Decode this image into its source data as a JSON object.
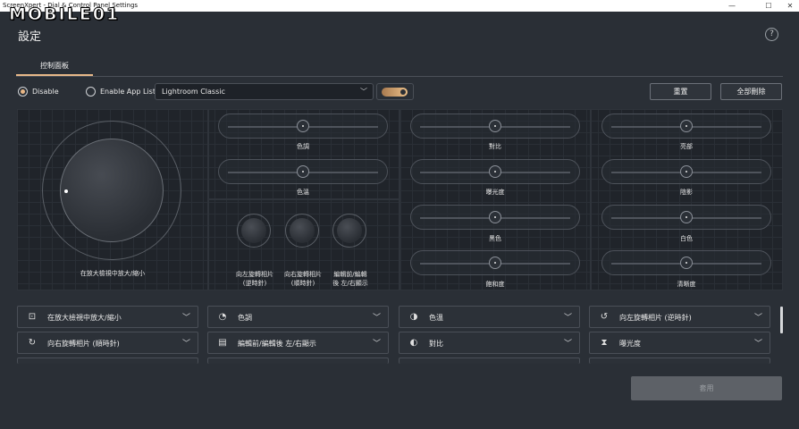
{
  "window": {
    "title": "ScreenXpert - Dial & Control Panel Settings",
    "controls": [
      "—",
      "☐",
      "✕"
    ],
    "watermark": "MOBILE01"
  },
  "header": {
    "title": "設定",
    "help": "?"
  },
  "tabs": [
    {
      "label": "控制面板",
      "active": true
    }
  ],
  "toolbar": {
    "disable_label": "Disable",
    "disable_selected": true,
    "enable_app_list_label": "Enable App List",
    "app_select_value": "Lightroom Classic",
    "toggle_on": true,
    "reset_label": "重置",
    "delete_all_label": "全部刪除"
  },
  "colors": {
    "accent": "#e9b786",
    "background": "#2a2f36",
    "panel": "#20242a"
  },
  "dial": {
    "label": "在放大檢視中放大/縮小"
  },
  "mini_dials": [
    {
      "label_line1": "向左旋轉相片",
      "label_line2": "(逆時針)"
    },
    {
      "label_line1": "向右旋轉相片",
      "label_line2": "(順時針)"
    },
    {
      "label_line1": "編輯前/編輯",
      "label_line2": "後 左/右顯示"
    }
  ],
  "sliders": [
    {
      "label": "色調",
      "value": 0.5
    },
    {
      "label": "色溫",
      "value": 0.5
    },
    {
      "label": "對比",
      "value": 0.5
    },
    {
      "label": "曝光度",
      "value": 0.5
    },
    {
      "label": "黑色",
      "value": 0.5
    },
    {
      "label": "飽和度",
      "value": 0.5
    },
    {
      "label": "亮部",
      "value": 0.5
    },
    {
      "label": "陰影",
      "value": 0.5
    },
    {
      "label": "白色",
      "value": 0.5
    },
    {
      "label": "清晰度",
      "value": 0.5
    }
  ],
  "assignments": [
    {
      "icon": "zoom-frame-icon",
      "glyph": "⊡",
      "label": "在放大檢視中放大/縮小"
    },
    {
      "icon": "tone-icon",
      "glyph": "◔",
      "label": "色調"
    },
    {
      "icon": "temperature-icon",
      "glyph": "◑",
      "label": "色溫"
    },
    {
      "icon": "rotate-left-icon",
      "glyph": "↺",
      "label": "向左旋轉相片 (逆時針)"
    },
    {
      "icon": "rotate-right-icon",
      "glyph": "↻",
      "label": "向右旋轉相片 (順時針)"
    },
    {
      "icon": "before-after-icon",
      "glyph": "▤",
      "label": "編輯前/編輯後 左/右顯示"
    },
    {
      "icon": "contrast-icon",
      "glyph": "◐",
      "label": "對比"
    },
    {
      "icon": "exposure-icon",
      "glyph": "⧗",
      "label": "曝光度"
    }
  ],
  "footer": {
    "apply_label": "套用"
  }
}
